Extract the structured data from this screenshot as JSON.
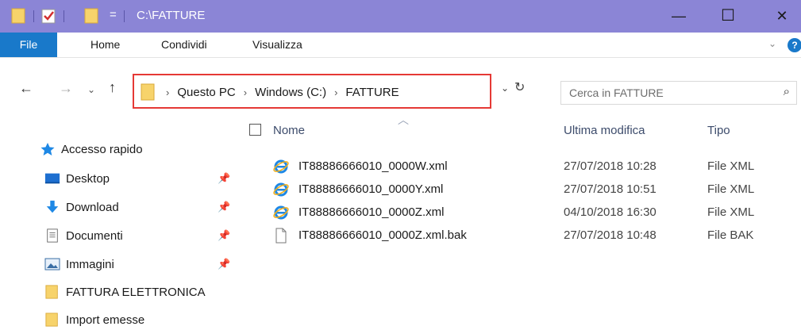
{
  "window": {
    "title": "C:\\FATTURE",
    "qa_dropdown": "=",
    "minimize": "—",
    "maximize": "☐",
    "close": "✕"
  },
  "ribbon": {
    "tabs": [
      "File",
      "Home",
      "Condividi",
      "Visualizza"
    ],
    "expand": "⌄",
    "help": "?"
  },
  "nav": {
    "back": "←",
    "forward": "→",
    "recent": "⌄",
    "up": "↑"
  },
  "address": {
    "crumbs": [
      "Questo PC",
      "Windows (C:)",
      "FATTURE"
    ],
    "separator": "›",
    "dropdown": "⌄",
    "refresh": "↻"
  },
  "search": {
    "placeholder": "Cerca in FATTURE",
    "icon": "⌕"
  },
  "sidebar": {
    "pin_glyph": "📌",
    "items": [
      {
        "label": "Accesso rapido",
        "icon": "star-icon",
        "pinned": false
      },
      {
        "label": "Desktop",
        "icon": "desktop-icon",
        "pinned": true
      },
      {
        "label": "Download",
        "icon": "download-icon",
        "pinned": true
      },
      {
        "label": "Documenti",
        "icon": "documents-icon",
        "pinned": true
      },
      {
        "label": "Immagini",
        "icon": "pictures-icon",
        "pinned": true
      },
      {
        "label": "FATTURA ELETTRONICA",
        "icon": "folder-icon",
        "pinned": false
      },
      {
        "label": "Import emesse",
        "icon": "folder-icon",
        "pinned": false
      }
    ]
  },
  "columns": {
    "name": "Nome",
    "modified": "Ultima modifica",
    "type": "Tipo"
  },
  "files": [
    {
      "name": "IT88886666010_0000W.xml",
      "modified": "27/07/2018 10:28",
      "type": "File XML",
      "icon": "ie-xml-icon"
    },
    {
      "name": "IT88886666010_0000Y.xml",
      "modified": "27/07/2018 10:51",
      "type": "File XML",
      "icon": "ie-xml-icon"
    },
    {
      "name": "IT88886666010_0000Z.xml",
      "modified": "04/10/2018 16:30",
      "type": "File XML",
      "icon": "ie-xml-icon"
    },
    {
      "name": "IT88886666010_0000Z.xml.bak",
      "modified": "27/07/2018 10:48",
      "type": "File BAK",
      "icon": "blank-file-icon"
    }
  ],
  "colors": {
    "titlebar": "#8b85d6",
    "file_tab": "#1979ca",
    "highlight_box": "#e53935",
    "folder": "#f7d36b"
  }
}
